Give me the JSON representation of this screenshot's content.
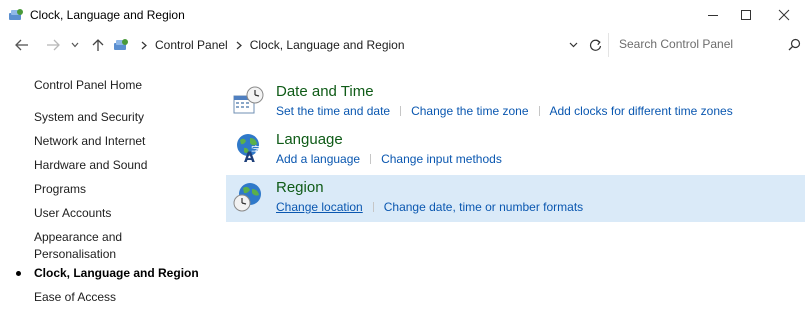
{
  "window": {
    "title": "Clock, Language and Region",
    "controls": [
      "minimize",
      "maximize",
      "close"
    ]
  },
  "addressbar": {
    "breadcrumb": [
      "Control Panel",
      "Clock, Language and Region"
    ],
    "search_placeholder": "Search Control Panel"
  },
  "sidebar": {
    "home": "Control Panel Home",
    "items": [
      {
        "label": "System and Security"
      },
      {
        "label": "Network and Internet"
      },
      {
        "label": "Hardware and Sound"
      },
      {
        "label": "Programs"
      },
      {
        "label": "User Accounts"
      },
      {
        "label": "Appearance and Personalisation"
      },
      {
        "label": "Clock, Language and Region",
        "current": true
      },
      {
        "label": "Ease of Access"
      }
    ]
  },
  "categories": [
    {
      "title": "Date and Time",
      "icon": "calendar-clock-icon",
      "links": [
        "Set the time and date",
        "Change the time zone",
        "Add clocks for different time zones"
      ]
    },
    {
      "title": "Language",
      "icon": "language-globe-icon",
      "links": [
        "Add a language",
        "Change input methods"
      ]
    },
    {
      "title": "Region",
      "icon": "region-globe-clock-icon",
      "highlighted": true,
      "links": [
        "Change location",
        "Change date, time or number formats"
      ]
    }
  ],
  "colors": {
    "category_title": "#0f5b17",
    "link": "#0a57b0",
    "highlight_bg": "#daeaf8"
  }
}
